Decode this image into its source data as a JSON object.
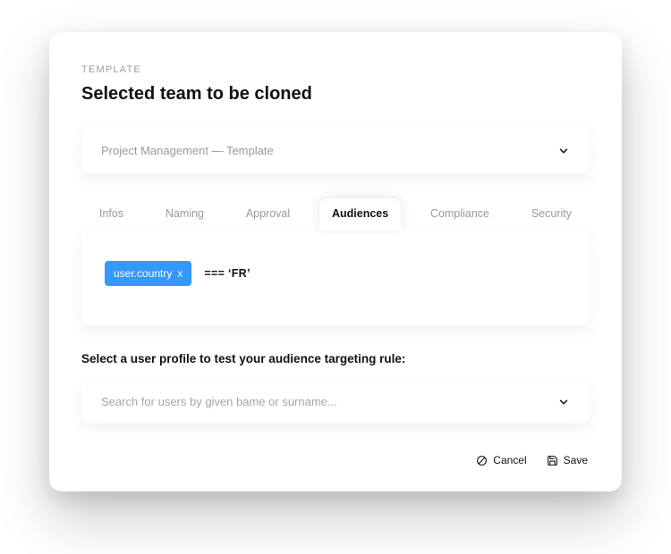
{
  "eyebrow": "TEMPLATE",
  "title": "Selected team to be cloned",
  "team_select": {
    "value": "Project Management — Template"
  },
  "tabs": [
    {
      "label": "Infos",
      "active": false
    },
    {
      "label": "Naming",
      "active": false
    },
    {
      "label": "Approval",
      "active": false
    },
    {
      "label": "Audiences",
      "active": true
    },
    {
      "label": "Compliance",
      "active": false
    },
    {
      "label": "Security",
      "active": false
    }
  ],
  "rule": {
    "chip_label": "user.country",
    "expression": "=== ‘FR’"
  },
  "test_section": {
    "heading": "Select a user profile to test your audience targeting rule:",
    "placeholder": "Search for users by given bame or surname..."
  },
  "footer": {
    "cancel": "Cancel",
    "save": "Save"
  }
}
